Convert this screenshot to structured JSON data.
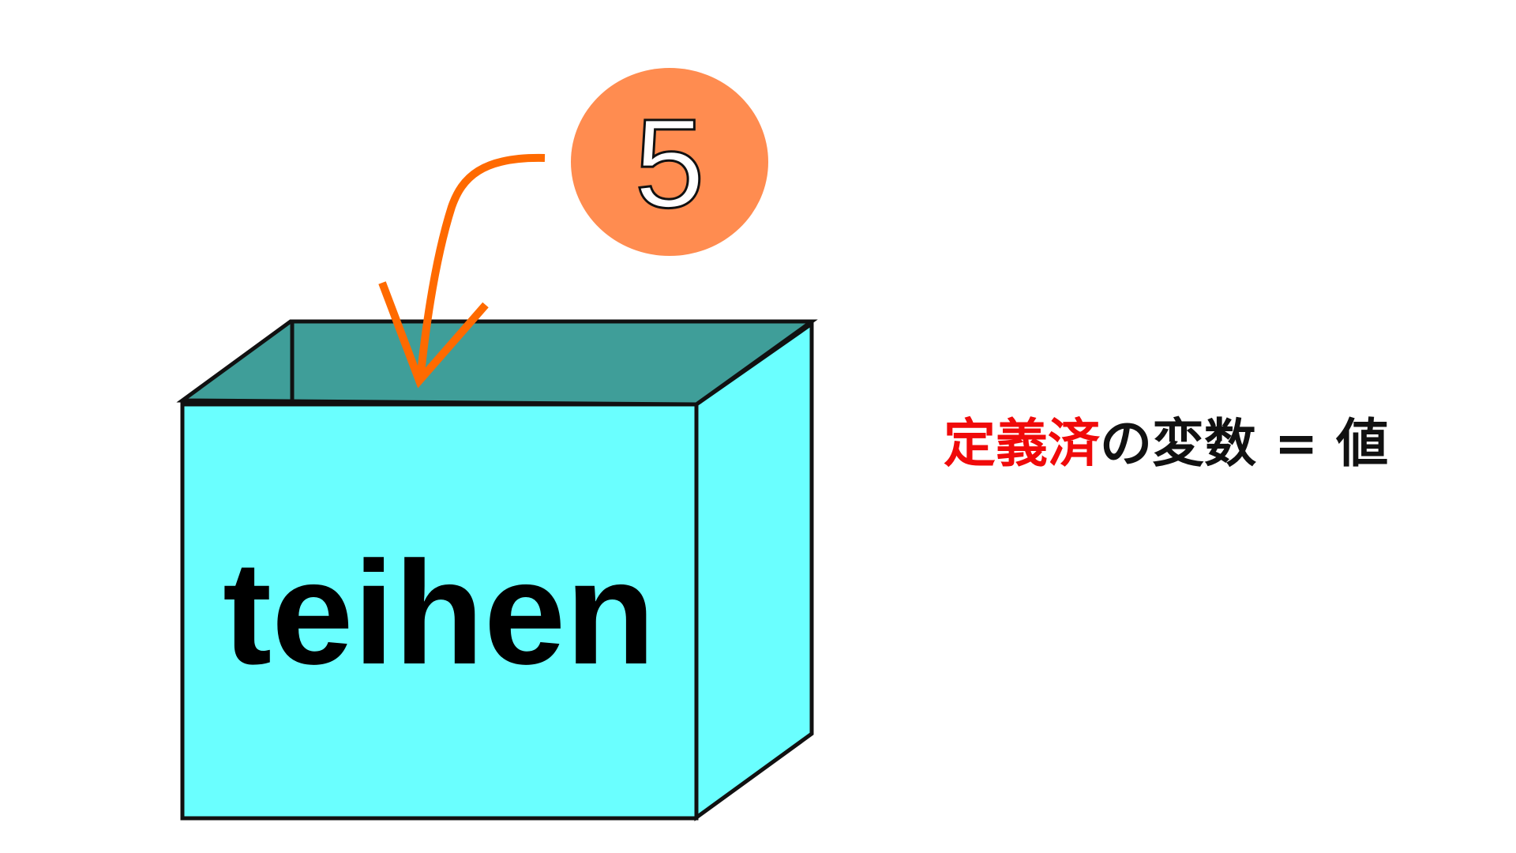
{
  "box": {
    "label": "teihen",
    "front_color": "#6affff",
    "top_color": "#3f9e99"
  },
  "value_bubble": {
    "value": "5",
    "color": "#ff8c50"
  },
  "arrow": {
    "color": "#ff6a00"
  },
  "caption": {
    "highlight": "定義済",
    "rest": "の変数 = 値",
    "highlight_color": "#f00a0a"
  }
}
